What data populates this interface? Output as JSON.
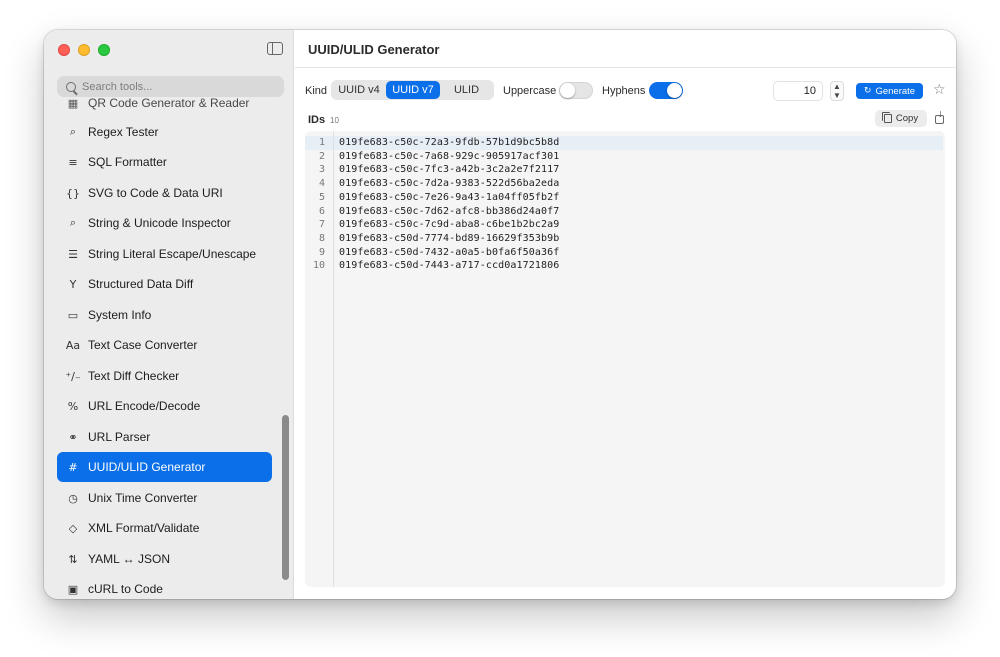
{
  "sidebar": {
    "search_placeholder": "Search tools...",
    "clipped_item_label": "QR Code Generator & Reader",
    "items": [
      {
        "label": "Regex Tester",
        "icon": "magnifier-icon"
      },
      {
        "label": "SQL Formatter",
        "icon": "lines-icon"
      },
      {
        "label": "SVG to Code & Data URI",
        "icon": "braces-icon"
      },
      {
        "label": "String & Unicode Inspector",
        "icon": "magnifier-text-icon"
      },
      {
        "label": "String Literal Escape/Unescape",
        "icon": "escape-icon"
      },
      {
        "label": "Structured Data Diff",
        "icon": "branch-icon"
      },
      {
        "label": "System Info",
        "icon": "display-icon"
      },
      {
        "label": "Text Case Converter",
        "icon": "text-case-icon"
      },
      {
        "label": "Text Diff Checker",
        "icon": "plus-minus-icon"
      },
      {
        "label": "URL Encode/Decode",
        "icon": "percent-icon"
      },
      {
        "label": "URL Parser",
        "icon": "link-icon"
      },
      {
        "label": "UUID/ULID Generator",
        "icon": "hash-icon",
        "active": true
      },
      {
        "label": "Unix Time Converter",
        "icon": "clock-icon"
      },
      {
        "label": "XML Format/Validate",
        "icon": "tag-icon"
      },
      {
        "label": "YAML ↔ JSON",
        "icon": "swap-icon"
      },
      {
        "label": "cURL to Code",
        "icon": "terminal-icon"
      }
    ]
  },
  "main": {
    "title": "UUID/ULID Generator",
    "kind_label": "Kind",
    "kind_options": [
      "UUID v4",
      "UUID v7",
      "ULID"
    ],
    "kind_selected": "UUID v7",
    "uppercase_label": "Uppercase",
    "uppercase_on": false,
    "hyphens_label": "Hyphens",
    "hyphens_on": true,
    "count_value": "10",
    "generate_label": "Generate",
    "ids_label": "IDs",
    "ids_count": "10",
    "copy_label": "Copy",
    "lines": [
      {
        "num": "1",
        "text": "019fe683-c50c-72a3-9fdb-57b1d9bc5b8d"
      },
      {
        "num": "2",
        "text": "019fe683-c50c-7a68-929c-905917acf301"
      },
      {
        "num": "3",
        "text": "019fe683-c50c-7fc3-a42b-3c2a2e7f2117"
      },
      {
        "num": "4",
        "text": "019fe683-c50c-7d2a-9383-522d56ba2eda"
      },
      {
        "num": "5",
        "text": "019fe683-c50c-7e26-9a43-1a04ff05fb2f"
      },
      {
        "num": "6",
        "text": "019fe683-c50c-7d62-afc8-bb386d24a0f7"
      },
      {
        "num": "7",
        "text": "019fe683-c50c-7c9d-aba8-c6be1b2bc2a9"
      },
      {
        "num": "8",
        "text": "019fe683-c50d-7774-bd89-16629f353b9b"
      },
      {
        "num": "9",
        "text": "019fe683-c50d-7432-a0a5-b0fa6f50a36f"
      },
      {
        "num": "10",
        "text": "019fe683-c50d-7443-a717-ccd0a1721806"
      }
    ]
  },
  "colors": {
    "accent": "#0a6fe8",
    "sidebar_bg": "#ececec",
    "editor_bg": "#f5f5f5"
  }
}
